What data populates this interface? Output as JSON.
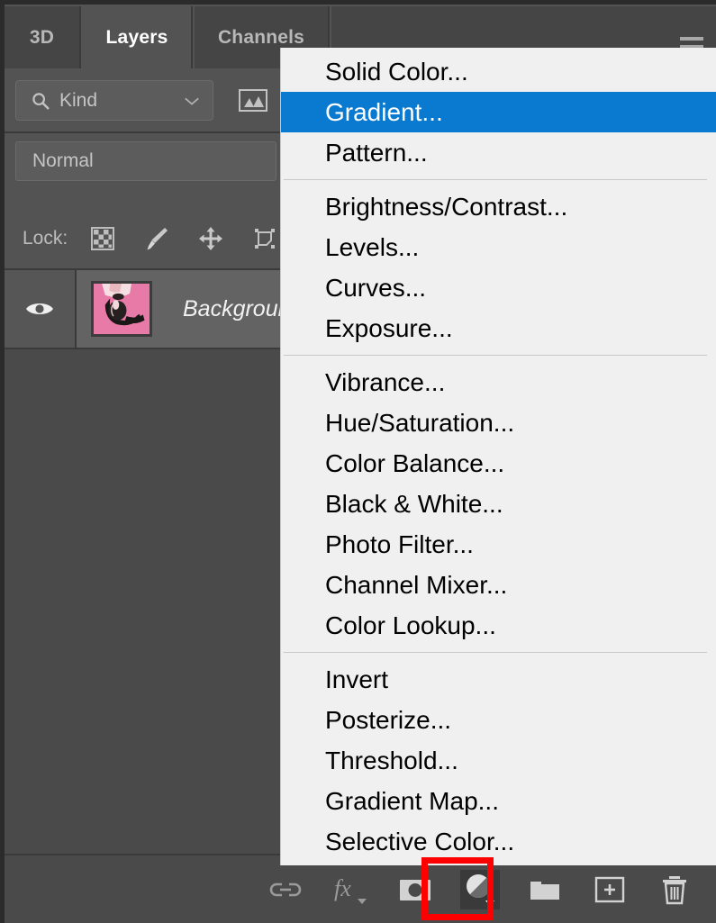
{
  "panel": {
    "tabs": [
      {
        "label": "3D",
        "active": false
      },
      {
        "label": "Layers",
        "active": true
      },
      {
        "label": "Channels",
        "active": false
      }
    ],
    "menu_button_icon": "hamburger-menu-icon",
    "filter": {
      "search_icon": "search-icon",
      "kind_label": "Kind",
      "caret_icon": "chevron-down-icon",
      "pixel_filter_icon": "image-layer-filter-icon"
    },
    "blend_mode": "Normal",
    "lock": {
      "label": "Lock:",
      "icons": [
        "transparency-checkerboard-icon",
        "paint-brush-icon",
        "move-arrows-icon",
        "artboard-nesting-icon"
      ]
    },
    "layers": [
      {
        "name": "Background",
        "visibility_icon": "eye-icon",
        "thumbnail": "pink-background-hair-photo",
        "selected": true
      }
    ],
    "bottom_toolbar": [
      {
        "icon": "link-layers-icon",
        "label": "Link layers",
        "pressed": false
      },
      {
        "icon": "fx-layer-style-icon",
        "label": "Add a layer style",
        "pressed": false
      },
      {
        "icon": "layer-mask-icon",
        "label": "Add layer mask",
        "pressed": false
      },
      {
        "icon": "adjustment-layer-icon",
        "label": "Create new fill or adjustment layer",
        "pressed": true
      },
      {
        "icon": "new-group-folder-icon",
        "label": "Create a new group",
        "pressed": false
      },
      {
        "icon": "new-layer-plus-icon",
        "label": "Create a new layer",
        "pressed": false
      },
      {
        "icon": "delete-trash-icon",
        "label": "Delete layer",
        "pressed": false
      }
    ],
    "highlight_color": "#fe0000"
  },
  "context_menu": {
    "highlight_color": "#0a7ad1",
    "groups": [
      {
        "items": [
          {
            "label": "Solid Color...",
            "selected": false
          },
          {
            "label": "Gradient...",
            "selected": true
          },
          {
            "label": "Pattern...",
            "selected": false
          }
        ]
      },
      {
        "items": [
          {
            "label": "Brightness/Contrast...",
            "selected": false
          },
          {
            "label": "Levels...",
            "selected": false
          },
          {
            "label": "Curves...",
            "selected": false
          },
          {
            "label": "Exposure...",
            "selected": false
          }
        ]
      },
      {
        "items": [
          {
            "label": "Vibrance...",
            "selected": false
          },
          {
            "label": "Hue/Saturation...",
            "selected": false
          },
          {
            "label": "Color Balance...",
            "selected": false
          },
          {
            "label": "Black & White...",
            "selected": false
          },
          {
            "label": "Photo Filter...",
            "selected": false
          },
          {
            "label": "Channel Mixer...",
            "selected": false
          },
          {
            "label": "Color Lookup...",
            "selected": false
          }
        ]
      },
      {
        "items": [
          {
            "label": "Invert",
            "selected": false
          },
          {
            "label": "Posterize...",
            "selected": false
          },
          {
            "label": "Threshold...",
            "selected": false
          },
          {
            "label": "Gradient Map...",
            "selected": false
          },
          {
            "label": "Selective Color...",
            "selected": false
          }
        ]
      }
    ]
  }
}
